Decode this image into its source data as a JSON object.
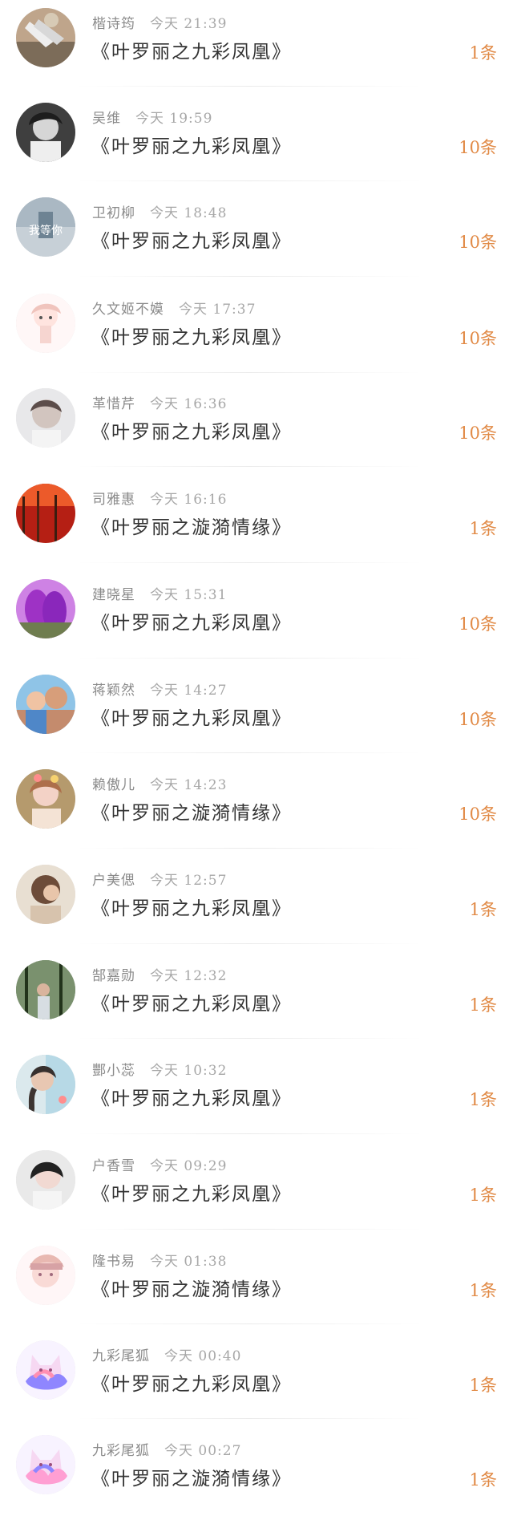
{
  "items": [
    {
      "name": "楷诗筠",
      "time": "今天 21:39",
      "title": "《叶罗丽之九彩凤凰》",
      "count": "1条",
      "avatar": "feet-photo"
    },
    {
      "name": "吴维",
      "time": "今天 19:59",
      "title": "《叶罗丽之九彩凤凰》",
      "count": "10条",
      "avatar": "bw-portrait"
    },
    {
      "name": "卫初柳",
      "time": "今天 18:48",
      "title": "《叶罗丽之九彩凤凰》",
      "count": "10条",
      "avatar": "rain-text-avatar",
      "avatar_text": "我等你"
    },
    {
      "name": "久文姬不嫫",
      "time": "今天 17:37",
      "title": "《叶罗丽之九彩凤凰》",
      "count": "10条",
      "avatar": "anime-girl"
    },
    {
      "name": "革惜芹",
      "time": "今天 16:36",
      "title": "《叶罗丽之九彩凤凰》",
      "count": "10条",
      "avatar": "soft-portrait"
    },
    {
      "name": "司雅惠",
      "time": "今天 16:16",
      "title": "《叶罗丽之漩漪情缘》",
      "count": "1条",
      "avatar": "autumn-forest"
    },
    {
      "name": "建晓星",
      "time": "今天 15:31",
      "title": "《叶罗丽之九彩凤凰》",
      "count": "10条",
      "avatar": "purple-tulips"
    },
    {
      "name": "蒋颖然",
      "time": "今天 14:27",
      "title": "《叶罗丽之九彩凤凰》",
      "count": "10条",
      "avatar": "family-photo"
    },
    {
      "name": "赖傲儿",
      "time": "今天 14:23",
      "title": "《叶罗丽之漩漪情缘》",
      "count": "10条",
      "avatar": "flower-girl"
    },
    {
      "name": "户美偲",
      "time": "今天 12:57",
      "title": "《叶罗丽之九彩凤凰》",
      "count": "1条",
      "avatar": "short-hair"
    },
    {
      "name": "郜嘉勋",
      "time": "今天 12:32",
      "title": "《叶罗丽之九彩凤凰》",
      "count": "1条",
      "avatar": "forest-person"
    },
    {
      "name": "酆小蕊",
      "time": "今天 10:32",
      "title": "《叶罗丽之九彩凤凰》",
      "count": "1条",
      "avatar": "braid-girl"
    },
    {
      "name": "户香雪",
      "time": "今天 09:29",
      "title": "《叶罗丽之九彩凤凰》",
      "count": "1条",
      "avatar": "dark-hair"
    },
    {
      "name": "隆书易",
      "time": "今天 01:38",
      "title": "《叶罗丽之漩漪情缘》",
      "count": "1条",
      "avatar": "pink-anime"
    },
    {
      "name": "九彩尾狐",
      "time": "今天 00:40",
      "title": "《叶罗丽之九彩凤凰》",
      "count": "1条",
      "avatar": "rainbow-fox"
    },
    {
      "name": "九彩尾狐",
      "time": "今天 00:27",
      "title": "《叶罗丽之漩漪情缘》",
      "count": "1条",
      "avatar": "rainbow-fox"
    }
  ],
  "colors": {
    "count": "#e18a46",
    "name": "#8a8a8a",
    "time": "#a7a7a7",
    "title": "#333333"
  }
}
